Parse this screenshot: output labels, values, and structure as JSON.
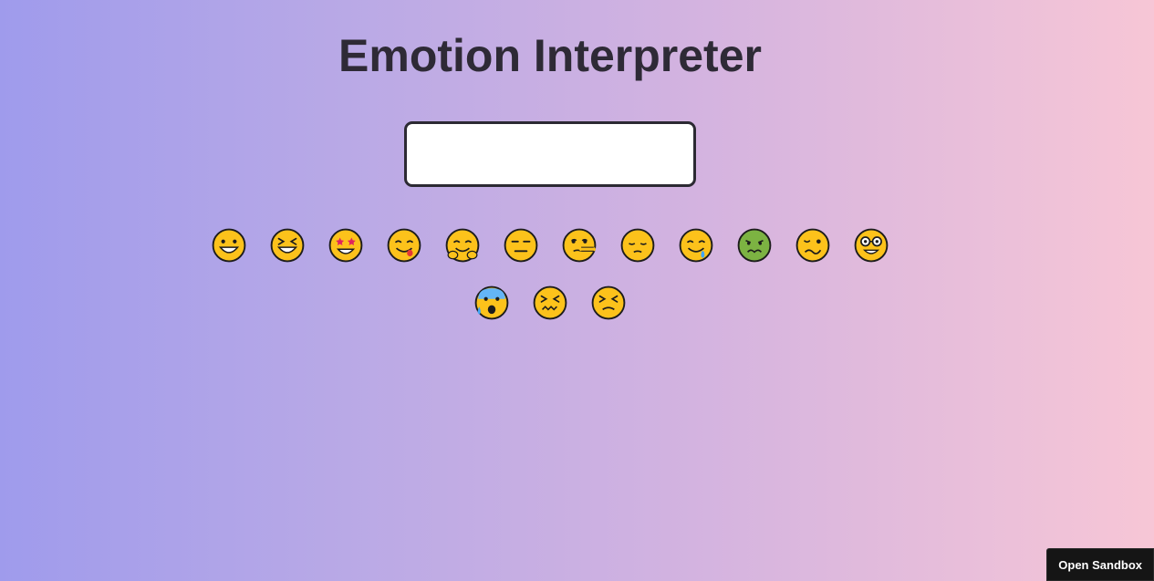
{
  "header": {
    "title": "Emotion Interpreter"
  },
  "input": {
    "value": "",
    "placeholder": ""
  },
  "emojis": [
    {
      "char": "😀",
      "icon": "grinning-face-icon"
    },
    {
      "char": "😆",
      "icon": "grinning-squinting-face-icon"
    },
    {
      "char": "🤩",
      "icon": "star-struck-icon"
    },
    {
      "char": "😋",
      "icon": "face-savoring-food-icon"
    },
    {
      "char": "🤗",
      "icon": "hugging-face-icon"
    },
    {
      "char": "😑",
      "icon": "expressionless-face-icon"
    },
    {
      "char": "🤥",
      "icon": "lying-face-icon"
    },
    {
      "char": "😔",
      "icon": "pensive-face-icon"
    },
    {
      "char": "🤤",
      "icon": "drooling-face-icon"
    },
    {
      "char": "🤢",
      "icon": "nauseated-face-icon"
    },
    {
      "char": "🥴",
      "icon": "woozy-face-icon"
    },
    {
      "char": "🤓",
      "icon": "nerd-face-icon"
    },
    {
      "char": "😰",
      "icon": "anxious-face-with-sweat-icon"
    },
    {
      "char": "😖",
      "icon": "confounded-face-icon"
    },
    {
      "char": "😣",
      "icon": "persevering-face-icon"
    }
  ],
  "footer": {
    "sandbox_label": "Open Sandbox"
  },
  "colors": {
    "gradient_start": "#9f9bec",
    "gradient_end": "#f7c6d6",
    "face_yellow": "#fcc21b",
    "face_green": "#7cb342",
    "outline": "#1c1c1c",
    "title": "#2e2a36"
  }
}
